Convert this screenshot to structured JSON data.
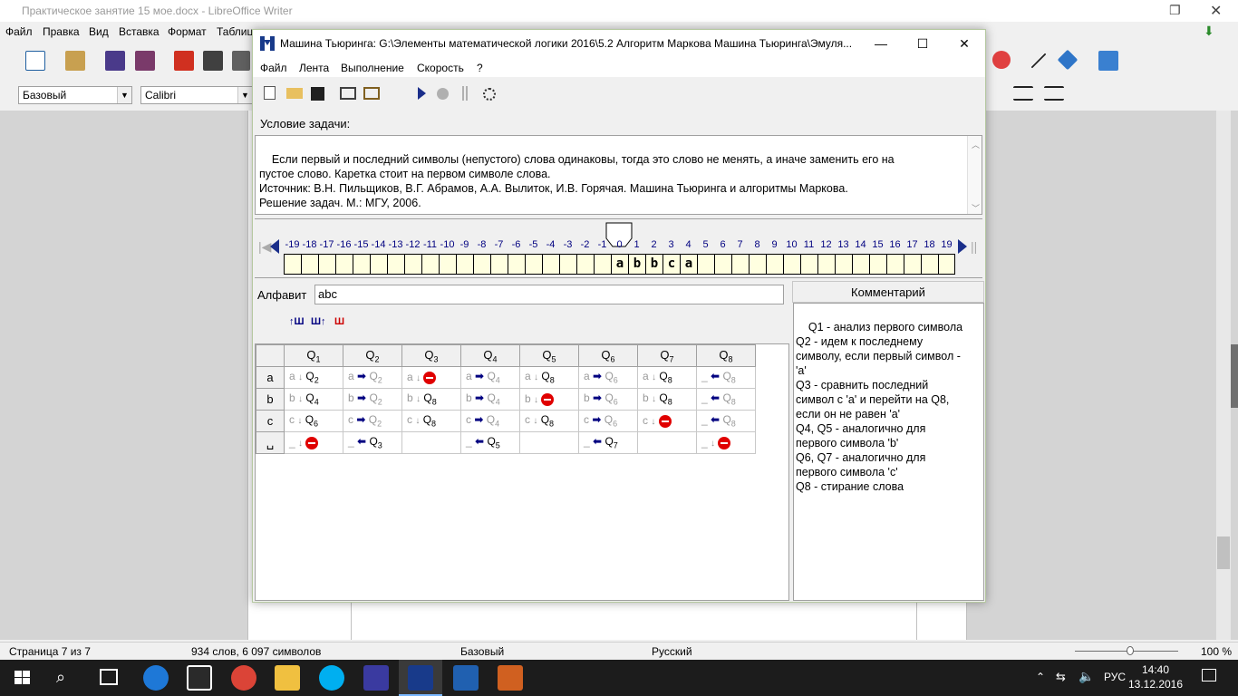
{
  "writer": {
    "title": "Практическое занятие 15 мое.docx - LibreOffice Writer",
    "menu": [
      "Файл",
      "Правка",
      "Вид",
      "Вставка",
      "Формат",
      "Таблица"
    ],
    "style_combo": "Базовый",
    "font_combo": "Calibri",
    "status": {
      "page": "Страница 7 из 7",
      "words": "934 слов, 6 097 символов",
      "style": "Базовый",
      "lang": "Русский",
      "zoom": "100 %"
    }
  },
  "dialog": {
    "title": "Машина Тьюринга: G:\\Элементы математической логики 2016\\5.2 Алгоритм Маркова Машина Тьюринга\\Эмуля...",
    "menu": [
      "Файл",
      "Лента",
      "Выполнение",
      "Скорость",
      "?"
    ],
    "condition_label": "Условие задачи:",
    "condition_text": "Если первый и последний символы (непустого) слова одинаковы, тогда это слово не менять, а иначе заменить его на\nпустое слово. Каретка стоит на первом символе слова.\nИсточник: В.Н. Пильщиков, В.Г. Абрамов, А.А. Вылиток, И.В. Горячая. Машина Тьюринга и алгоритмы Маркова.\nРешение задач. М.: МГУ, 2006.",
    "tape": {
      "start": -19,
      "end": 19,
      "head": 0,
      "symbols": {
        "0": "a",
        "1": "b",
        "2": "b",
        "3": "c",
        "4": "a"
      }
    },
    "alphabet_label": "Алфавит",
    "alphabet_value": "abc",
    "comment_header": "Комментарий",
    "comment_text": "Q1 - анализ первого символа\nQ2 - идем к последнему\nсимволу, если первый символ -\n'a'\nQ3 - сравнить последний\nсимвол с 'a' и перейти на Q8,\nесли он не равен 'a'\nQ4, Q5 - аналогично для\nпервого символа 'b'\nQ6, Q7 - аналогично для\nпервого символа 'c'\nQ8 - стирание слова",
    "states": [
      "1",
      "2",
      "3",
      "4",
      "5",
      "6",
      "7",
      "8"
    ],
    "rows": [
      {
        "sym": "a",
        "cells": [
          {
            "w": "a",
            "m": "d",
            "q": "2",
            "gq": false
          },
          {
            "w": "a",
            "m": "r",
            "q": "2",
            "gq": true
          },
          {
            "w": "a",
            "m": "d",
            "q": "stop",
            "gq": false
          },
          {
            "w": "a",
            "m": "r",
            "q": "4",
            "gq": true
          },
          {
            "w": "a",
            "m": "d",
            "q": "8",
            "gq": false
          },
          {
            "w": "a",
            "m": "r",
            "q": "6",
            "gq": true
          },
          {
            "w": "a",
            "m": "d",
            "q": "8",
            "gq": false
          },
          {
            "w": "_",
            "m": "l",
            "q": "8",
            "gq": true
          }
        ]
      },
      {
        "sym": "b",
        "cells": [
          {
            "w": "b",
            "m": "d",
            "q": "4",
            "gq": false
          },
          {
            "w": "b",
            "m": "r",
            "q": "2",
            "gq": true
          },
          {
            "w": "b",
            "m": "d",
            "q": "8",
            "gq": false
          },
          {
            "w": "b",
            "m": "r",
            "q": "4",
            "gq": true
          },
          {
            "w": "b",
            "m": "d",
            "q": "stop",
            "gq": false
          },
          {
            "w": "b",
            "m": "r",
            "q": "6",
            "gq": true
          },
          {
            "w": "b",
            "m": "d",
            "q": "8",
            "gq": false
          },
          {
            "w": "_",
            "m": "l",
            "q": "8",
            "gq": true
          }
        ]
      },
      {
        "sym": "c",
        "cells": [
          {
            "w": "c",
            "m": "d",
            "q": "6",
            "gq": false
          },
          {
            "w": "c",
            "m": "r",
            "q": "2",
            "gq": true
          },
          {
            "w": "c",
            "m": "d",
            "q": "8",
            "gq": false
          },
          {
            "w": "c",
            "m": "r",
            "q": "4",
            "gq": true
          },
          {
            "w": "c",
            "m": "d",
            "q": "8",
            "gq": false
          },
          {
            "w": "c",
            "m": "r",
            "q": "6",
            "gq": true
          },
          {
            "w": "c",
            "m": "d",
            "q": "stop",
            "gq": false
          },
          {
            "w": "_",
            "m": "l",
            "q": "8",
            "gq": true
          }
        ]
      },
      {
        "sym": "␣",
        "cells": [
          {
            "w": "_",
            "m": "d",
            "q": "stop",
            "gq": false
          },
          {
            "w": "_",
            "m": "l",
            "q": "3",
            "gq": false
          },
          null,
          {
            "w": "_",
            "m": "l",
            "q": "5",
            "gq": false
          },
          null,
          {
            "w": "_",
            "m": "l",
            "q": "7",
            "gq": false
          },
          null,
          {
            "w": "_",
            "m": "d",
            "q": "stop",
            "gq": false
          }
        ]
      }
    ]
  },
  "taskbar": {
    "lang": "РУС",
    "time": "14:40",
    "date": "13.12.2016"
  }
}
